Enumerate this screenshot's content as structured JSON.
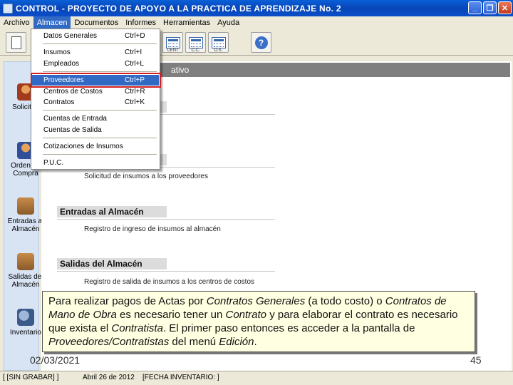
{
  "window": {
    "title": "CONTROL - PROYECTO DE APOYO A LA PRACTICA DE APRENDIZAJE No. 2",
    "controls": [
      "minimize",
      "restore",
      "close"
    ]
  },
  "menubar": {
    "items": [
      "Archivo",
      "Almacen",
      "Documentos",
      "Informes",
      "Herramientas",
      "Ayuda"
    ]
  },
  "toolbar": {
    "captions": [
      "CENT",
      "C.C.",
      "D.S."
    ],
    "help_label": "?"
  },
  "dropdown": {
    "items": [
      {
        "label": "Datos Generales",
        "shortcut": "Ctrl+D"
      },
      {
        "label": "Insumos",
        "shortcut": "Ctrl+I"
      },
      {
        "label": "Empleados",
        "shortcut": "Ctrl+L"
      },
      {
        "label": "Proveedores",
        "shortcut": "Ctrl+P"
      },
      {
        "label": "Centros de Costos",
        "shortcut": "Ctrl+R"
      },
      {
        "label": "Contratos",
        "shortcut": "Ctrl+K"
      },
      {
        "label": "Cuentas de Entrada",
        "shortcut": ""
      },
      {
        "label": "Cuentas de Salida",
        "shortcut": ""
      },
      {
        "label": "Cotizaciones de Insumos",
        "shortcut": ""
      },
      {
        "label": "P.U.C.",
        "shortcut": ""
      }
    ]
  },
  "leftpanel": {
    "items": [
      {
        "label": "Solicitud"
      },
      {
        "label": "Orden de Compra"
      },
      {
        "label": "Entradas al Almacén"
      },
      {
        "label": "Salidas del Almacén"
      },
      {
        "label": "Inventario"
      }
    ]
  },
  "main": {
    "header": "ativo",
    "sections": [
      {
        "title": "",
        "text": "insumos"
      },
      {
        "title": "",
        "text": "Solicitud de insumos a los proveedores"
      },
      {
        "title": "Entradas al Almacén",
        "text": "Registro de ingreso de insumos al almacén"
      },
      {
        "title": "Salidas del Almacén",
        "text": "Registro de salida de insumos a los centros de costos"
      }
    ]
  },
  "statusbar": {
    "left": "[ [SIN GRABAR] ]",
    "date": "Abril 26 de 2012",
    "inventory": "[FECHA INVENTARIO: ]"
  },
  "note": {
    "t1": "Para realizar pagos de Actas por ",
    "t2": "Contratos Generales",
    "t3": " (a todo costo) o ",
    "t4": "Contratos de Mano de Obra",
    "t5": " es necesario tener un ",
    "t6": "Contrato",
    "t7": " y para elaborar el contrato es necesario que exista el ",
    "t8": "Contratista",
    "t9": ". El primer paso entonces es acceder a la pantalla de ",
    "t10": "Proveedores/Contratistas",
    "t11": " del menú ",
    "t12": "Edición",
    "t13": "."
  },
  "slide": {
    "date": "02/03/2021",
    "page": "45"
  }
}
